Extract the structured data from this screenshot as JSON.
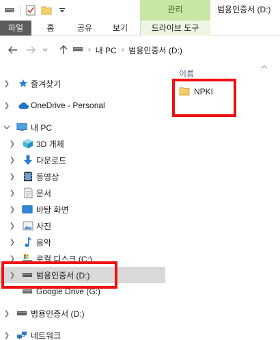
{
  "titlebar": {
    "context_tab_header": "관리",
    "window_title": "범용인증서 (D:)"
  },
  "ribbon": {
    "tabs": [
      "파일",
      "홈",
      "공유",
      "보기",
      "드라이브 도구"
    ]
  },
  "address": {
    "crumbs": [
      "내 PC",
      "범용인증서 (D:)"
    ]
  },
  "navpane": {
    "items": [
      {
        "label": "즐겨찾기",
        "icon": "star-icon"
      },
      {
        "label": "OneDrive - Personal",
        "icon": "cloud-icon"
      },
      {
        "label": "내 PC",
        "icon": "computer-icon"
      },
      {
        "label": "3D 개체",
        "icon": "cube-3d-icon"
      },
      {
        "label": "다운로드",
        "icon": "download-icon"
      },
      {
        "label": "동영상",
        "icon": "video-icon"
      },
      {
        "label": "문서",
        "icon": "document-icon"
      },
      {
        "label": "바탕 화면",
        "icon": "desktop-icon"
      },
      {
        "label": "사진",
        "icon": "picture-icon"
      },
      {
        "label": "음악",
        "icon": "music-icon"
      },
      {
        "label": "로컬 디스크 (C:)",
        "icon": "drive-icon"
      },
      {
        "label": "범용인증서 (D:)",
        "icon": "usb-drive-icon"
      },
      {
        "label": "Google Drive (G:)",
        "icon": "drive-icon"
      },
      {
        "label": "범용인증서 (D:)",
        "icon": "usb-drive-icon"
      },
      {
        "label": "네트워크",
        "icon": "network-icon"
      }
    ]
  },
  "content": {
    "column_header": "이름",
    "files": [
      {
        "name": "NPKI",
        "icon": "folder-icon"
      }
    ]
  },
  "colors": {
    "context_tab": "#c8e6a6",
    "file_tab": "#5c5c5c",
    "selection": "#d9d9d9",
    "annotation": "#ee1111",
    "folder": "#f3cf6b"
  }
}
